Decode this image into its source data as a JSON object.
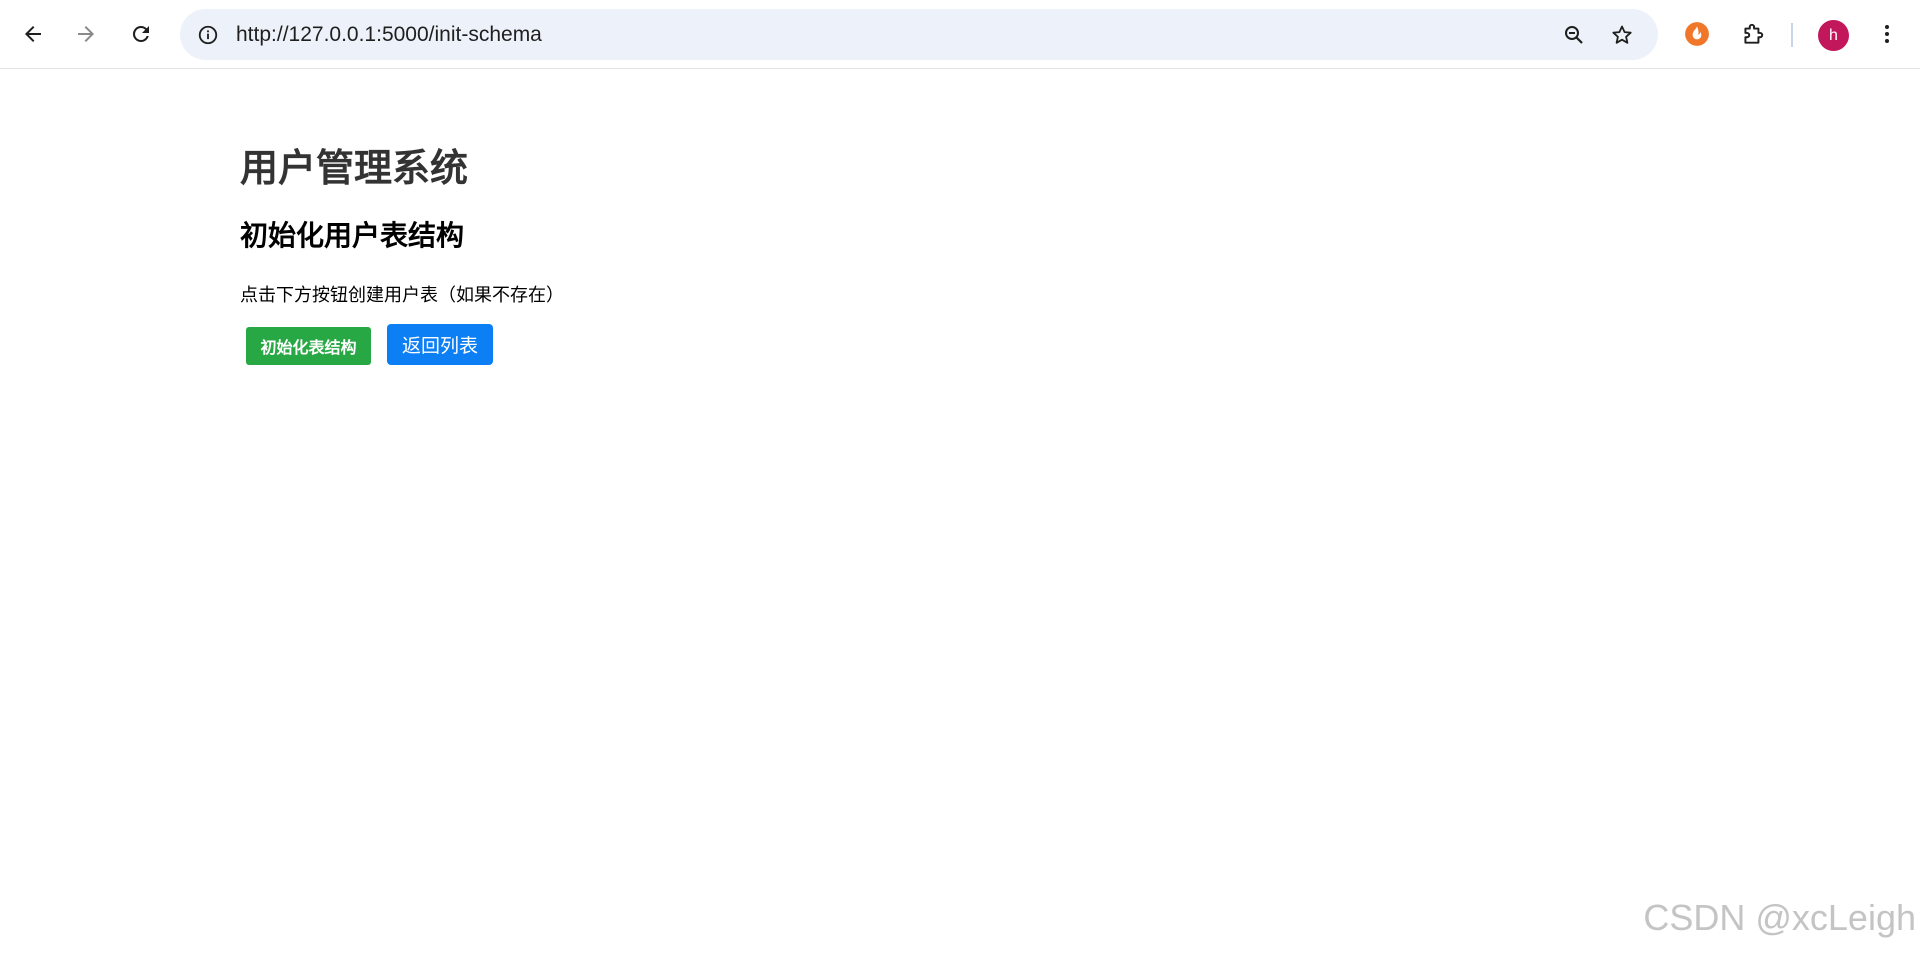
{
  "browser": {
    "url": "http://127.0.0.1:5000/init-schema",
    "profile_initial": "h",
    "icons": {
      "back": "arrow-left-icon",
      "forward": "arrow-right-icon",
      "reload": "reload-icon",
      "site_info": "info-icon",
      "zoom": "zoom-out-icon",
      "bookmark": "star-icon",
      "extension": "extension-icon",
      "extensions_menu": "puzzle-icon",
      "menu": "more-vert-icon"
    },
    "colors": {
      "omnibox": "#edf2fa",
      "avatar": "#c2185b",
      "extension": "#f0772a"
    }
  },
  "page": {
    "title": "用户管理系统",
    "section_title": "初始化用户表结构",
    "description": "点击下方按钮创建用户表（如果不存在）",
    "init_button_label": "初始化表结构",
    "back_button_label": "返回列表",
    "colors": {
      "init_button": "#28a745",
      "back_button": "#0d7ff5"
    }
  },
  "watermark": "CSDN @xcLeigh"
}
